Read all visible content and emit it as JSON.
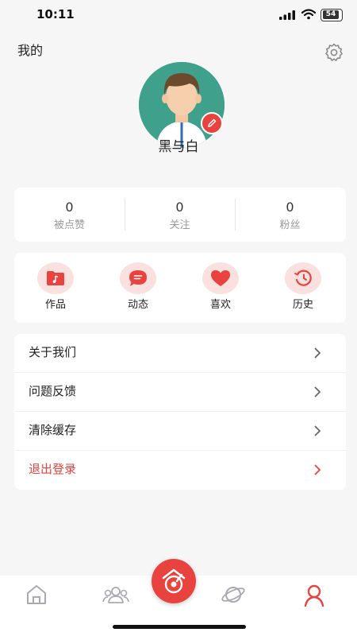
{
  "status_bar": {
    "time": "10:11",
    "battery": "54"
  },
  "header": {
    "title": "我的",
    "settings_icon": "gear-icon"
  },
  "profile": {
    "username": "黑与白",
    "avatar_bg": "#3fa18c",
    "edit_icon": "pencil-icon"
  },
  "stats": [
    {
      "value": "0",
      "label": "被点赞"
    },
    {
      "value": "0",
      "label": "关注"
    },
    {
      "value": "0",
      "label": "粉丝"
    }
  ],
  "actions": [
    {
      "label": "作品",
      "icon": "music-folder-icon"
    },
    {
      "label": "动态",
      "icon": "chat-bubble-icon"
    },
    {
      "label": "喜欢",
      "icon": "heart-icon"
    },
    {
      "label": "历史",
      "icon": "history-clock-icon"
    }
  ],
  "menu": [
    {
      "label": "关于我们"
    },
    {
      "label": "问题反馈"
    },
    {
      "label": "清除缓存"
    },
    {
      "label": "退出登录"
    }
  ],
  "tabbar": {
    "tabs": [
      "home-icon",
      "friends-icon",
      "center-record-icon",
      "planet-icon",
      "profile-icon"
    ],
    "active": "profile-icon"
  },
  "colors": {
    "accent": "#e8433f",
    "icon_bg": "#fbe0e0",
    "tab_inactive": "#a9a9b3"
  }
}
